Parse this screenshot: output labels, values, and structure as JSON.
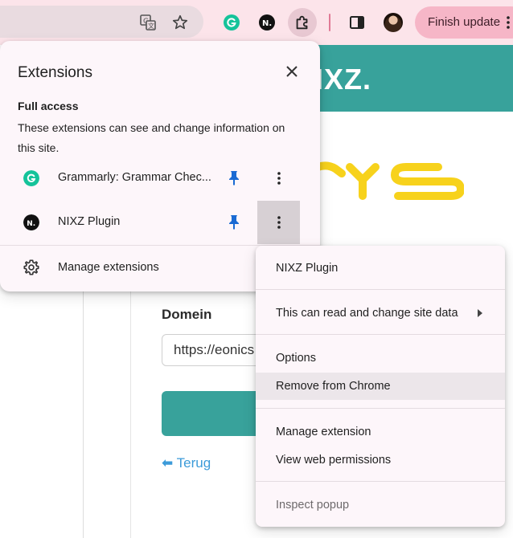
{
  "toolbar": {
    "finish_update_label": "Finish update",
    "icons": [
      "translate-icon",
      "bookmark-star-icon",
      "grammarly-icon",
      "nixz-icon",
      "extensions-puzzle-icon",
      "side-panel-icon",
      "profile-avatar",
      "more-menu-icon"
    ]
  },
  "page": {
    "header_text": "IXZ.",
    "domein_label": "Domein",
    "domein_value": "https://eonics",
    "back_link": "Terug",
    "back_arrow": "⬅",
    "colors": {
      "teal": "#38a29b",
      "logo_yellow": "#f7d21c",
      "link_blue": "#3c9bd9"
    }
  },
  "extensions_popup": {
    "title": "Extensions",
    "section_title": "Full access",
    "section_desc": "These extensions can see and change information on this site.",
    "items": [
      {
        "name": "Grammarly: Grammar Chec...",
        "logo_letter": "G",
        "logo_color": "#15c39a",
        "pinned": true
      },
      {
        "name": "NIXZ Plugin",
        "logo_letter": "N.",
        "logo_color": "#111111",
        "pinned": true
      }
    ],
    "manage_label": "Manage extensions",
    "pin_color": "#1a6ad3"
  },
  "context_menu": {
    "header": "NIXZ Plugin",
    "site_data": "This can read and change site data",
    "options": "Options",
    "remove": "Remove from Chrome",
    "manage_extension": "Manage extension",
    "view_permissions": "View web permissions",
    "inspect_popup": "Inspect popup"
  }
}
